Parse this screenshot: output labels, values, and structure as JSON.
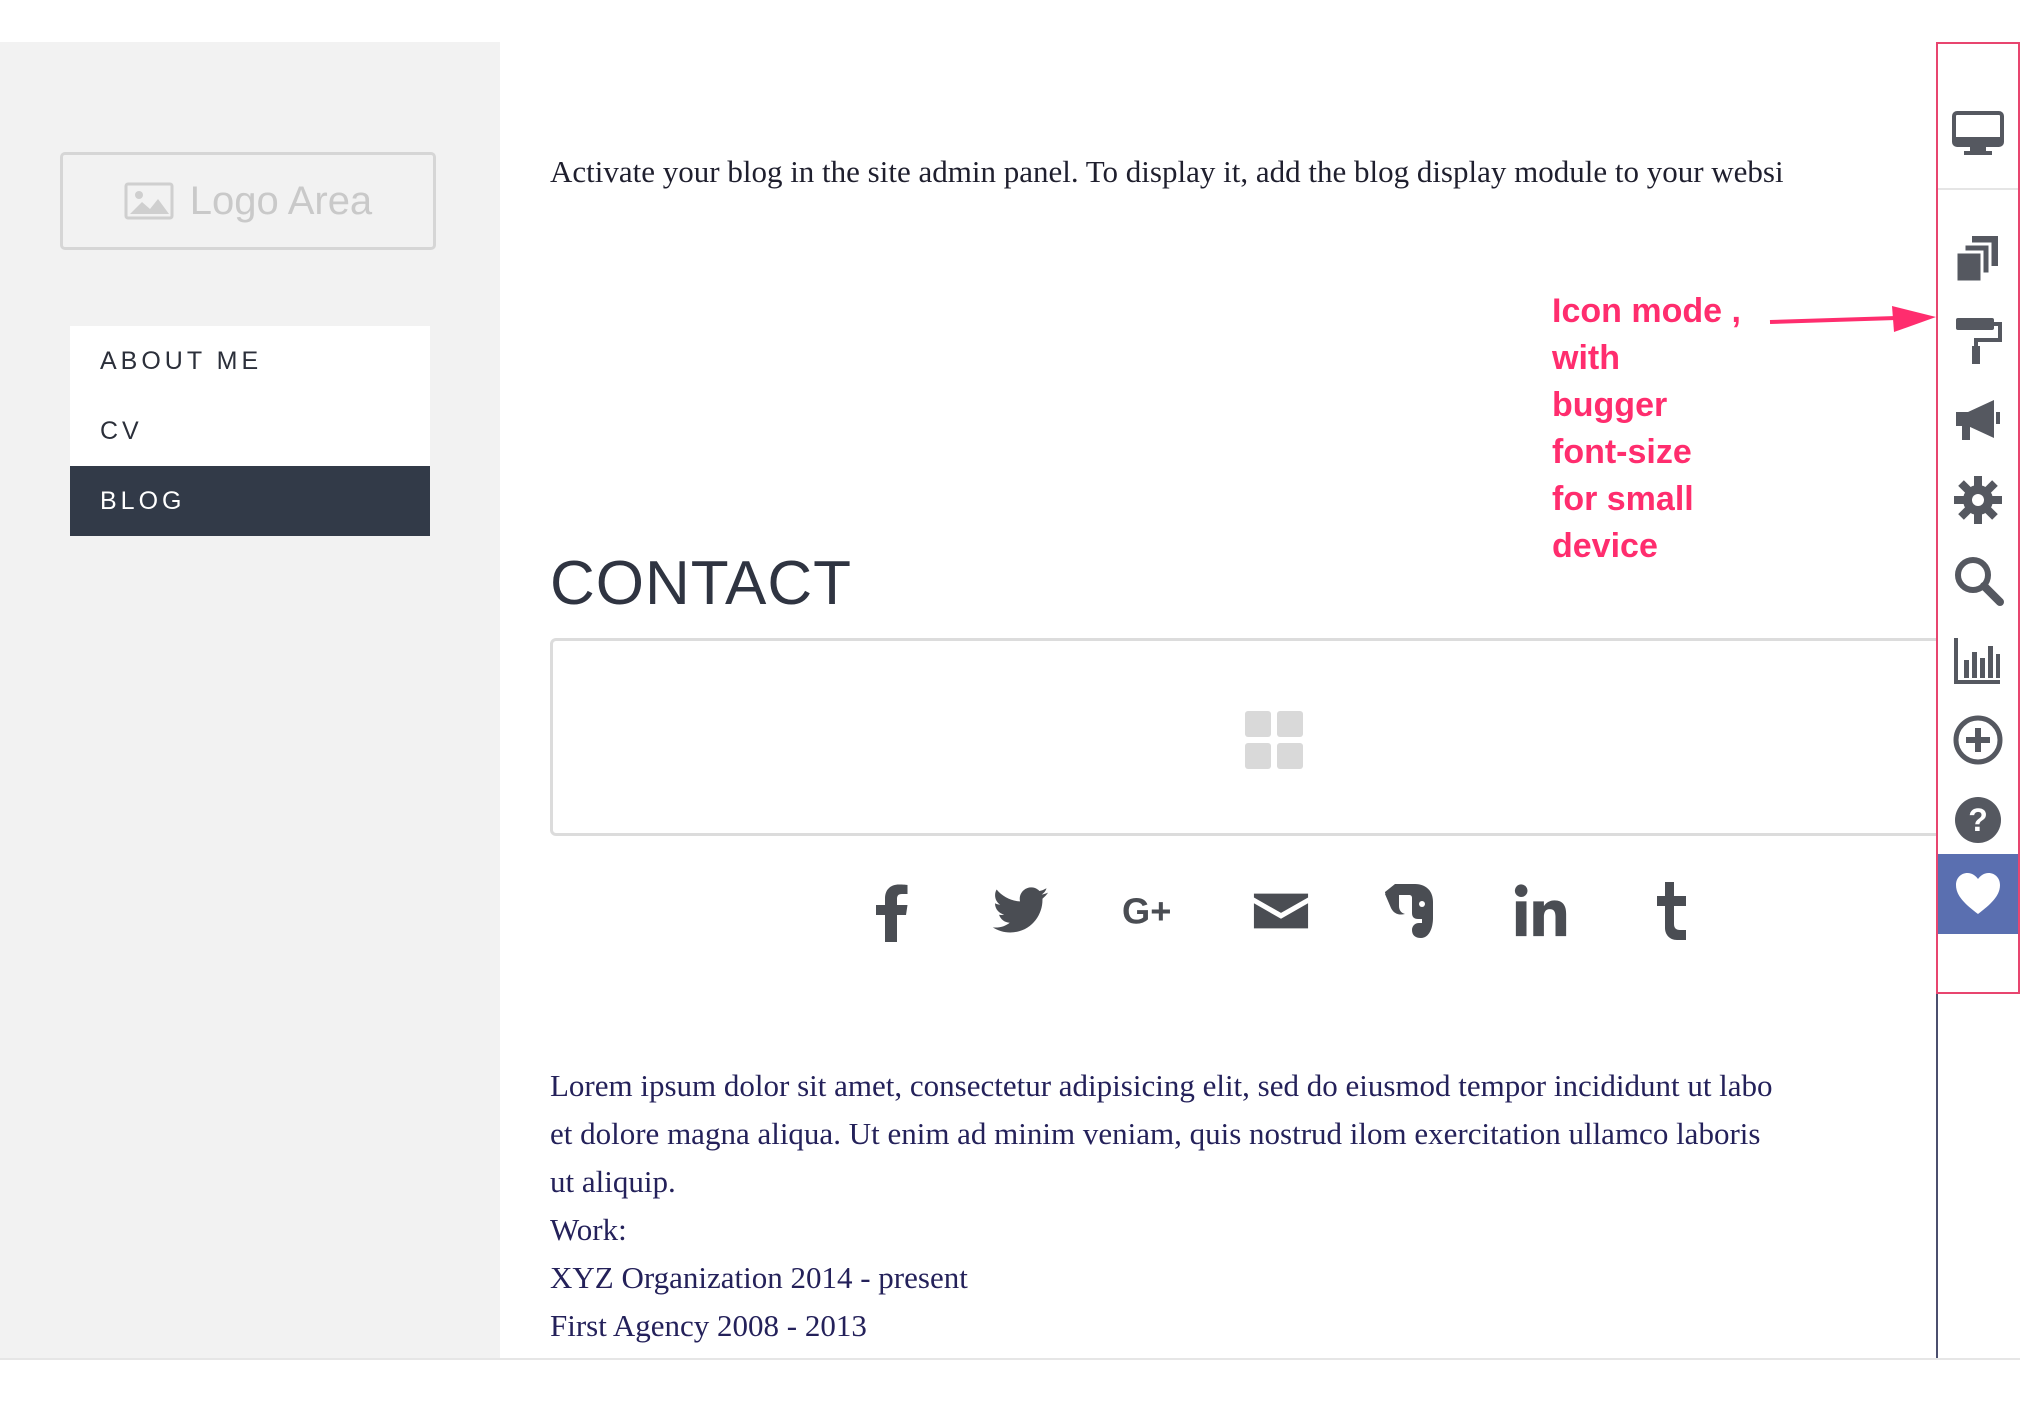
{
  "sidebar": {
    "logo_label": "Logo Area",
    "nav": [
      {
        "label": "ABOUT ME",
        "active": false
      },
      {
        "label": "CV",
        "active": false
      },
      {
        "label": "BLOG",
        "active": true
      }
    ]
  },
  "main": {
    "intro_text": "Activate your blog in the site admin panel. To display it, add the blog display module to your websi",
    "contact_title": "CONTACT",
    "social_icons": [
      "facebook-icon",
      "twitter-icon",
      "google-plus-icon",
      "email-icon",
      "evernote-icon",
      "linkedin-icon",
      "tumblr-icon"
    ],
    "body_lines": [
      "Lorem ipsum dolor sit amet, consectetur adipisicing elit, sed do eiusmod tempor incididunt ut labo",
      "et dolore magna aliqua. Ut enim ad minim veniam, quis nostrud ilom exercitation ullamco laboris",
      "ut aliquip.",
      "Work:",
      "XYZ Organization 2014 - present",
      "First Agency 2008 - 2013"
    ]
  },
  "toolbar": {
    "icons": [
      "desktop-icon",
      "pages-icon",
      "paint-roller-icon",
      "megaphone-icon",
      "gear-icon",
      "search-icon",
      "bar-chart-icon",
      "plus-circle-icon",
      "help-icon",
      "heart-icon"
    ],
    "accent": "#5a6fb0",
    "border": "#e8456f"
  },
  "annotation": {
    "lines": [
      "Icon mode ,",
      "with",
      "bugger",
      "font-size",
      "for small",
      "device"
    ],
    "color": "#ff2d6e"
  }
}
